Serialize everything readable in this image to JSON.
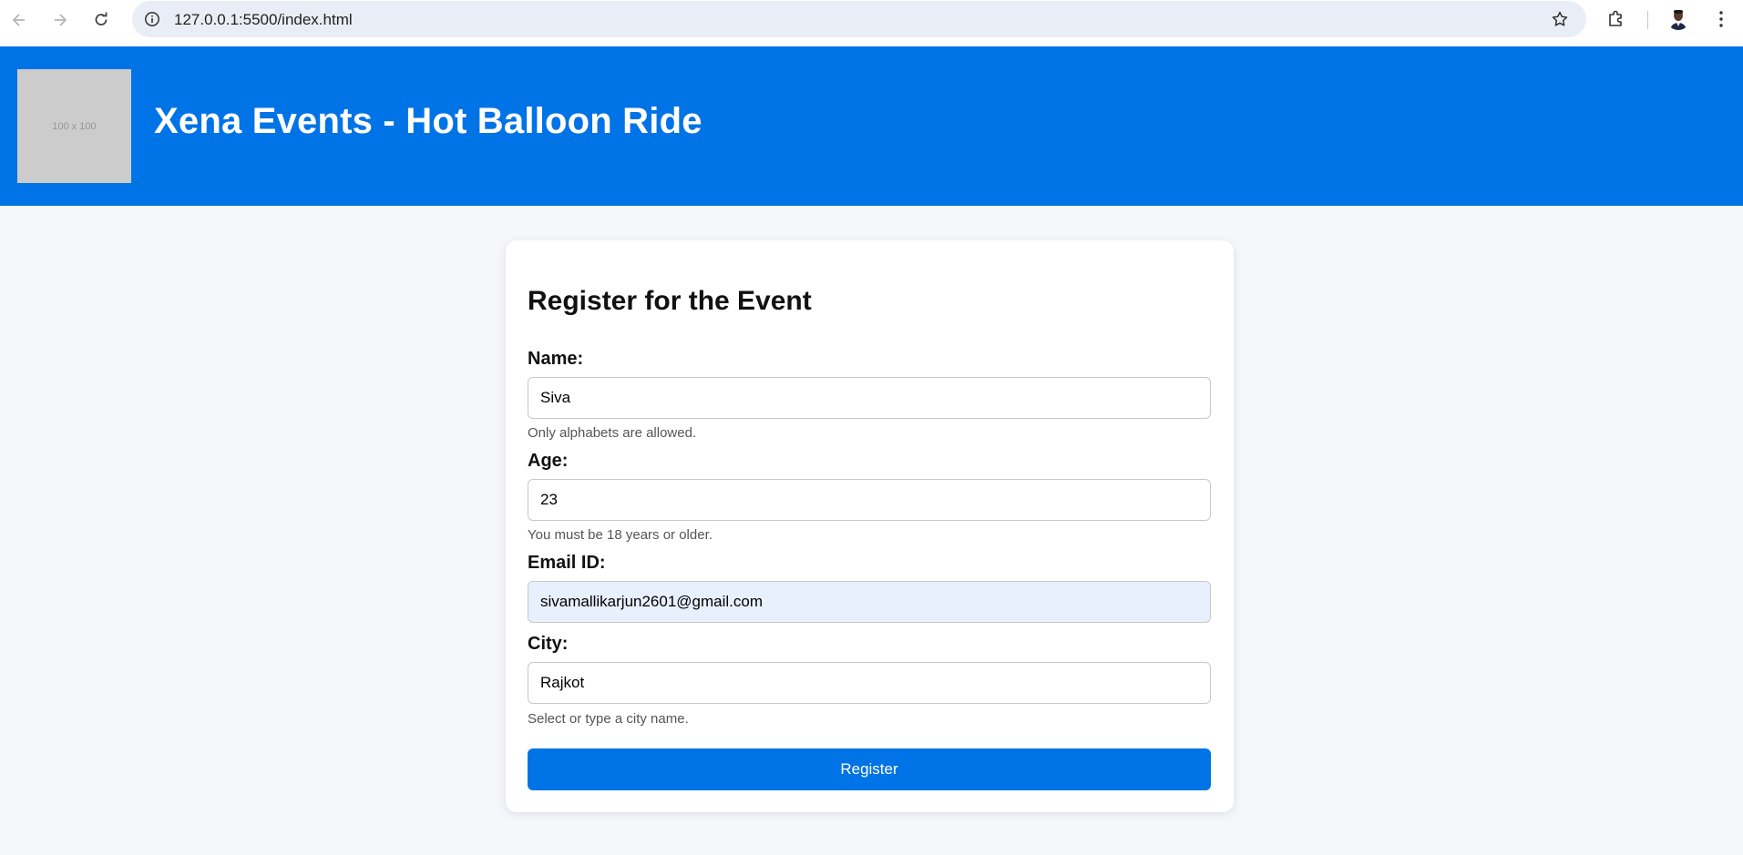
{
  "browser": {
    "url": "127.0.0.1:5500/index.html",
    "icons": {
      "back": "back-arrow-icon",
      "forward": "forward-arrow-icon",
      "reload": "reload-icon",
      "site_info": "info-icon",
      "bookmark": "star-icon",
      "extensions": "puzzle-icon",
      "menu": "kebab-menu-icon"
    }
  },
  "header": {
    "logo_placeholder": "100 x 100",
    "title": "Xena Events - Hot Balloon Ride",
    "background": "#0073e6"
  },
  "form": {
    "heading": "Register for the Event",
    "name": {
      "label": "Name:",
      "value": "Siva",
      "hint": "Only alphabets are allowed."
    },
    "age": {
      "label": "Age:",
      "value": "23",
      "hint": "You must be 18 years or older."
    },
    "email": {
      "label": "Email ID:",
      "value": "sivamallikarjun2601@gmail.com"
    },
    "city": {
      "label": "City:",
      "value": "Rajkot",
      "hint": "Select or type a city name."
    },
    "submit_label": "Register",
    "accent": "#0073e6"
  }
}
